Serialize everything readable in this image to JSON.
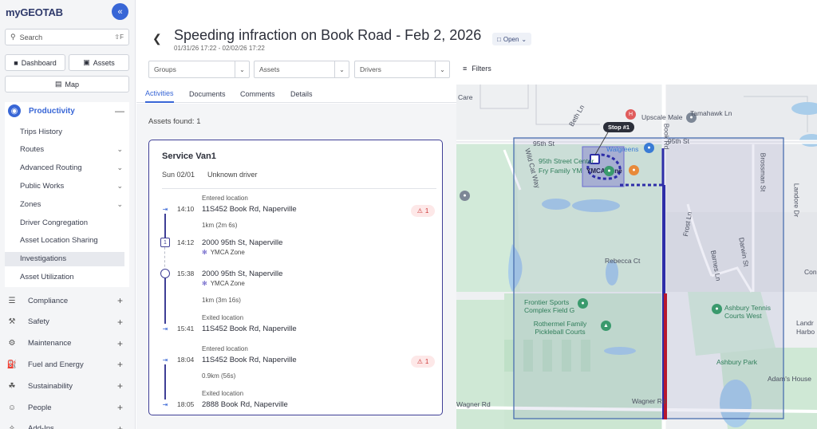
{
  "app": {
    "logo": "myGEOTAB"
  },
  "sidebar": {
    "collapse_icon": "«",
    "search": {
      "placeholder": "Search",
      "shortcut": "⇧F"
    },
    "buttons": {
      "dashboard": "Dashboard",
      "assets": "Assets",
      "map": "Map"
    },
    "productivity": {
      "label": "Productivity",
      "items": [
        {
          "label": "Trips History",
          "chevron": false
        },
        {
          "label": "Routes",
          "chevron": true
        },
        {
          "label": "Advanced Routing",
          "chevron": true
        },
        {
          "label": "Public Works",
          "chevron": true
        },
        {
          "label": "Zones",
          "chevron": true
        },
        {
          "label": "Driver Congregation",
          "chevron": false
        },
        {
          "label": "Asset Location Sharing",
          "chevron": false
        },
        {
          "label": "Investigations",
          "chevron": false,
          "active": true
        },
        {
          "label": "Asset Utilization",
          "chevron": false
        }
      ]
    },
    "categories": [
      {
        "label": "Compliance",
        "icon": "clipboard-icon"
      },
      {
        "label": "Safety",
        "icon": "wrench-icon"
      },
      {
        "label": "Maintenance",
        "icon": "spanner-icon"
      },
      {
        "label": "Fuel and Energy",
        "icon": "fuel-icon"
      },
      {
        "label": "Sustainability",
        "icon": "leaf-icon"
      },
      {
        "label": "People",
        "icon": "people-icon"
      },
      {
        "label": "Add-Ins",
        "icon": "puzzle-icon"
      }
    ]
  },
  "header": {
    "title": "Speeding infraction on Book Road - Feb 2, 2026",
    "daterange": "01/31/26 17:22 - 02/02/26 17:22",
    "status": "Open",
    "dropdowns": {
      "groups": "Groups",
      "assets": "Assets",
      "drivers": "Drivers"
    },
    "filters": "Filters"
  },
  "tabs": [
    "Activities",
    "Documents",
    "Comments",
    "Details"
  ],
  "panel": {
    "assets_found": "Assets found: 1",
    "vehicle": "Service Van1",
    "date": "Sun 02/01",
    "driver": "Unknown driver",
    "events": [
      {
        "time": "14:10",
        "kind": "Entered location",
        "address": "11S452 Book Rd, Naperville",
        "alerts": "1",
        "distance": "1km (2m 6s)"
      },
      {
        "time": "14:12",
        "kind": "",
        "address": "2000 95th St, Naperville",
        "zone": "YMCA Zone"
      },
      {
        "time": "15:38",
        "kind": "",
        "address": "2000 95th St, Naperville",
        "zone": "YMCA Zone",
        "distance": "1km (3m 16s)"
      },
      {
        "time": "15:41",
        "kind": "Exited location",
        "address": "11S452 Book Rd, Naperville"
      },
      {
        "time": "18:04",
        "kind": "Entered location",
        "address": "11S452 Book Rd, Naperville",
        "alerts": "1",
        "distance": "0.9km (56s)"
      },
      {
        "time": "18:05",
        "kind": "Exited location",
        "address": "2888 Book Rd, Naperville"
      }
    ]
  },
  "map": {
    "stop_label": "Stop #1",
    "zone_label": "YMCA Zone",
    "labels": {
      "care": "Care",
      "tamahawk": "Tamahawk Ln",
      "beth": "Beth Ln",
      "upscale": "Upscale Male",
      "st95_left": "95th St",
      "st95_right": "95th St",
      "walgreens": "Walgreens",
      "center": "95th Street Center",
      "fry": "Fry Family YM",
      "wildcat": "Wild Cat Way",
      "book_rd": "Book Rd",
      "brossman": "Brossman St",
      "landore": "Landore Dr",
      "frost": "Frost Ln",
      "darwin": "Darwin St",
      "barnes": "Barnes Ln",
      "rebecca": "Rebecca Ct",
      "con": "Con",
      "frontier": "Frontier Sports Complex Field G",
      "rothermel": "Rothermel Family Pickleball Courts",
      "ashbury_tennis": "Ashbury Tennis Courts West",
      "landr": "Landr",
      "harbo": "Harbo",
      "ashbury_park": "Ashbury Park",
      "adams": "Adam's House",
      "wagner_left": "Wagner Rd",
      "wagner_right": "Wagner Rd"
    },
    "colors": {
      "zone": "#3f3f96",
      "route_speeding": "#b8182e",
      "route": "#2e2ea8"
    }
  }
}
